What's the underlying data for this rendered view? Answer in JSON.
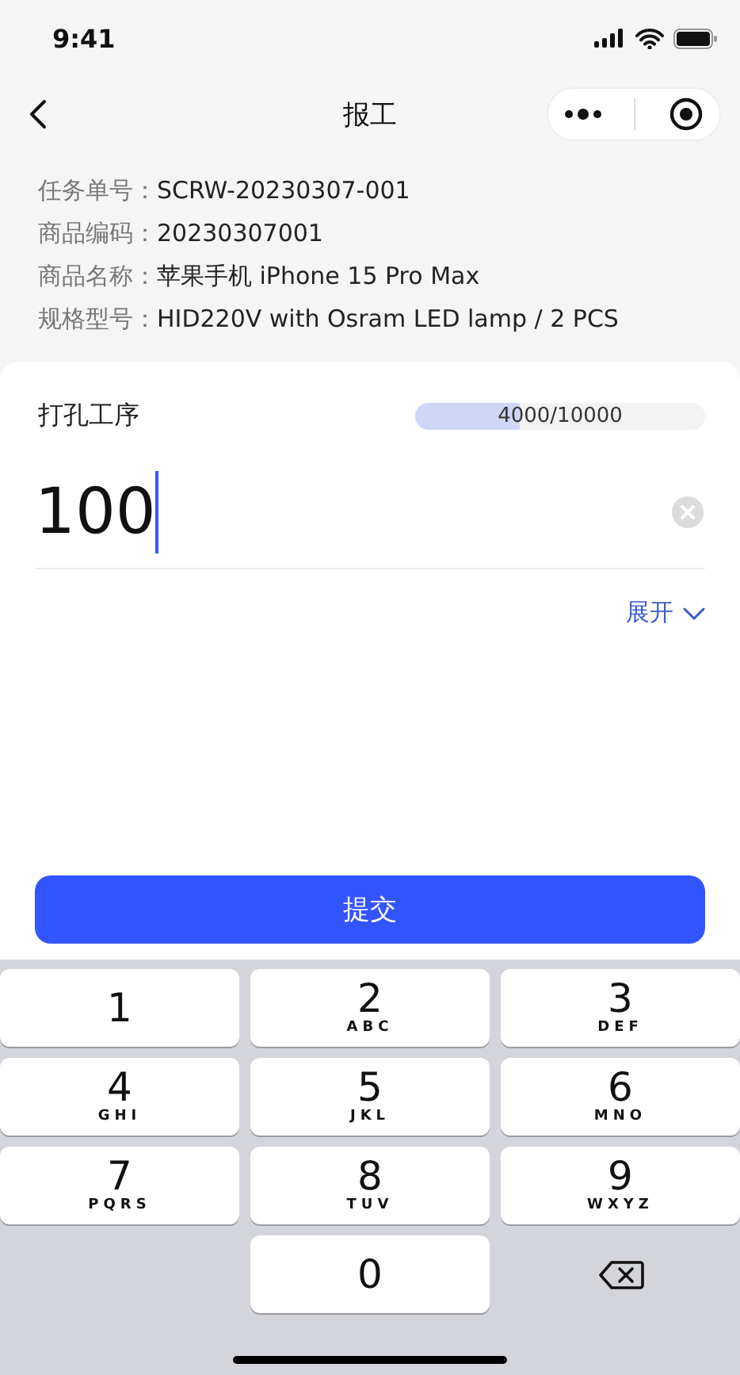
{
  "status_bar": {
    "time": "9:41"
  },
  "nav": {
    "title": "报工"
  },
  "info": [
    {
      "label": "任务单号：",
      "value": "SCRW-20230307-001"
    },
    {
      "label": "商品编码：",
      "value": "20230307001"
    },
    {
      "label": "商品名称：",
      "value": "苹果手机 iPhone 15 Pro Max"
    },
    {
      "label": "规格型号：",
      "value": "HID220V with Osram LED lamp / 2 PCS"
    }
  ],
  "process": {
    "name": "打孔工序",
    "progress_text": "4000/10000",
    "level": 0.36
  },
  "quantity_input": {
    "value": "100"
  },
  "expand_link": "展开",
  "submit_button": "提交",
  "keypad": [
    {
      "kind": "digit",
      "digit": "1"
    },
    {
      "kind": "digit",
      "digit": "2",
      "letters": "ABC"
    },
    {
      "kind": "digit",
      "digit": "3",
      "letters": "DEF"
    },
    {
      "kind": "digit",
      "digit": "4",
      "letters": "GHI"
    },
    {
      "kind": "digit",
      "digit": "5",
      "letters": "JKL"
    },
    {
      "kind": "digit",
      "digit": "6",
      "letters": "MNO"
    },
    {
      "kind": "digit",
      "digit": "7",
      "letters": "PQRS"
    },
    {
      "kind": "digit",
      "digit": "8",
      "letters": "TUV"
    },
    {
      "kind": "digit",
      "digit": "9",
      "letters": "WXYZ"
    },
    {
      "kind": "blank"
    },
    {
      "kind": "digit",
      "digit": "0"
    },
    {
      "kind": "delete"
    }
  ]
}
